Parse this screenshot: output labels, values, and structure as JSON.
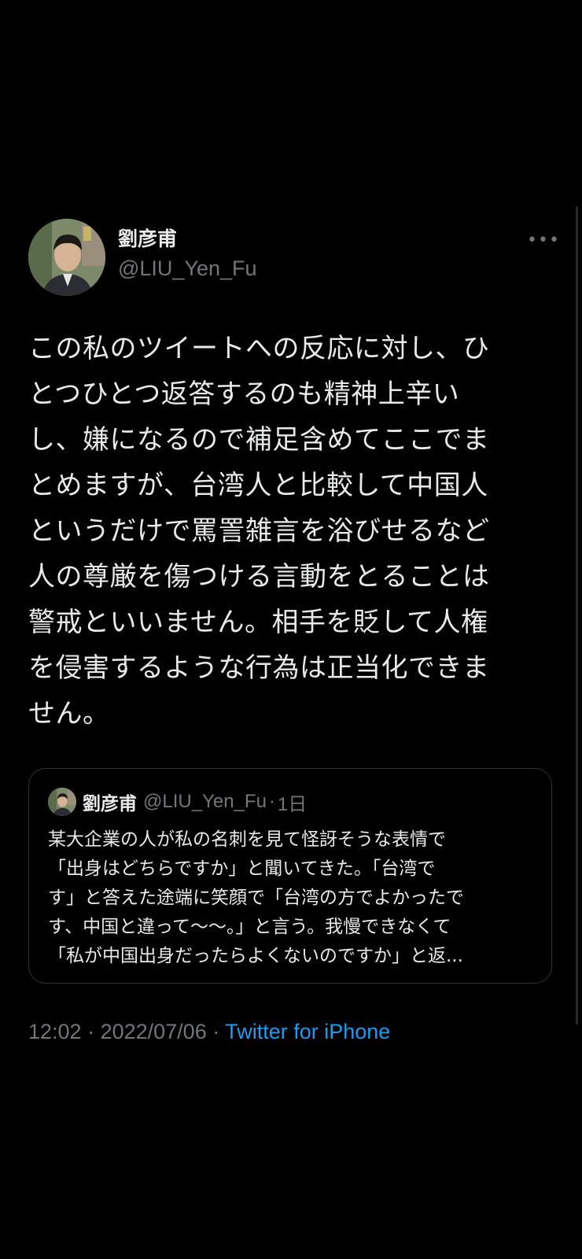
{
  "author": {
    "display_name": "劉彦甫",
    "handle": "@LIU_Yen_Fu",
    "avatar_icon": "profile-photo"
  },
  "more_icon": "more-options-icon",
  "tweet": {
    "text": "この私のツイートへの反応に対し、ひ\nとつひとつ返答するのも精神上辛い\nし、嫌になるので補足含めてここでま\nとめますが、台湾人と比較して中国人\nというだけで罵詈雑言を浴びせるなど\n人の尊厳を傷つける言動をとることは\n警戒といいません。相手を貶して人権\nを侵害するような行為は正当化できま\nせん。"
  },
  "quoted_tweet": {
    "display_name": "劉彦甫",
    "handle": "@LIU_Yen_Fu",
    "separator": "·",
    "time": "1日",
    "text": "某大企業の人が私の名刺を見て怪訝そうな表情で\n「出身はどちらですか」と聞いてきた。「台湾で\nす」と答えた途端に笑顔で「台湾の方でよかったで\nす、中国と違って〜〜。」と言う。我慢できなくて\n「私が中国出身だったらよくないのですか」と返..."
  },
  "meta": {
    "time": "12:02",
    "sep1": " · ",
    "date": "2022/07/06",
    "sep2": " · ",
    "source": "Twitter for iPhone"
  },
  "colors": {
    "background": "#000000",
    "text": "#e7e9ea",
    "secondary": "#71767b",
    "link": "#1d9bf0",
    "border": "#2f3336"
  }
}
